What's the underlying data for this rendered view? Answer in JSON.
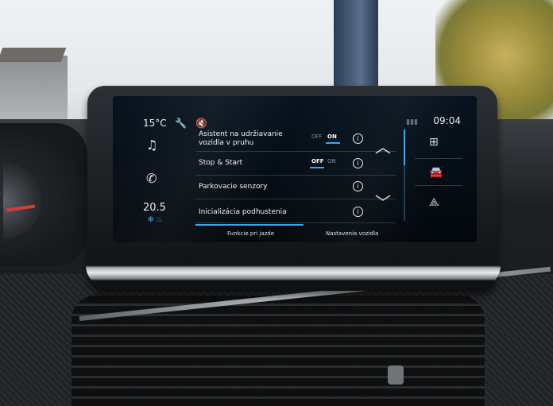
{
  "status_bar": {
    "temperature": "15°C",
    "time": "09:04",
    "icons": [
      "wrench-icon",
      "muted-speaker-icon",
      "signal-icon"
    ]
  },
  "left_rail": {
    "icons": [
      "music-note-icon",
      "phone-icon"
    ],
    "climate_temp": "20.5",
    "climate_icons": [
      "fan-icon",
      "seat-heat-icon"
    ]
  },
  "settings_list": {
    "items": [
      {
        "label": "Asistent na udržiavanie vozidla v pruhu",
        "toggle": {
          "off": "OFF",
          "on": "ON",
          "state": "on"
        }
      },
      {
        "label": "Stop & Start",
        "toggle": {
          "off": "OFF",
          "on": "ON",
          "state": "off"
        }
      },
      {
        "label": "Parkovacie senzory"
      },
      {
        "label": "Inicializácia podhustenia"
      }
    ],
    "info_symbol": "i"
  },
  "scroll": {
    "up": "︿",
    "down": "﹀"
  },
  "right_rail": {
    "icons": [
      "grid-apps-icon",
      "car-icon",
      "navigation-arrow-icon"
    ]
  },
  "tabs": [
    {
      "label": "Funkcie pri jazde",
      "active": true
    },
    {
      "label": "Nastavenia vozidla",
      "active": false
    }
  ],
  "colors": {
    "accent": "#2fa8f2",
    "screen_bg": "#05101a"
  }
}
